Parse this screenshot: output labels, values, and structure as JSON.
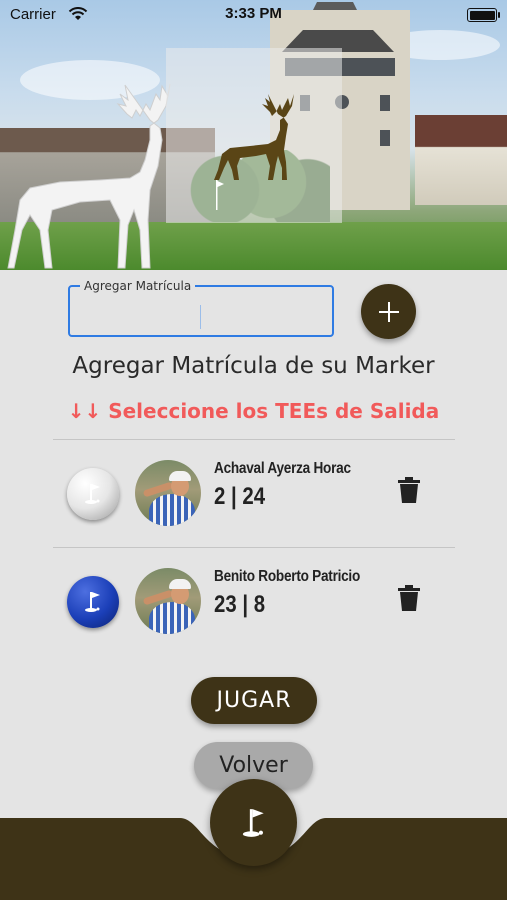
{
  "status_bar": {
    "carrier": "Carrier",
    "time": "3:33 PM"
  },
  "hero": {
    "image": "golf-club-with-deer-statue",
    "logo": "deer-logo"
  },
  "form": {
    "label": "Agregar Matrícula",
    "value": "",
    "add_button_icon": "plus-icon"
  },
  "title": "Agregar Matrícula de su Marker",
  "subtitle": "↓↓ Seleccione los TEEs de Salida",
  "players": [
    {
      "tee_color": "white",
      "name": "Achaval Ayerza Horac",
      "stats": "2 | 24"
    },
    {
      "tee_color": "blue",
      "name": "Benito Roberto Patricio",
      "stats": "23 | 8"
    }
  ],
  "buttons": {
    "jugar": "JUGAR",
    "volver": "Volver"
  },
  "colors": {
    "brand": "#3e3317",
    "accent_red": "#f15a5a",
    "input_focus": "#2f7be3"
  }
}
